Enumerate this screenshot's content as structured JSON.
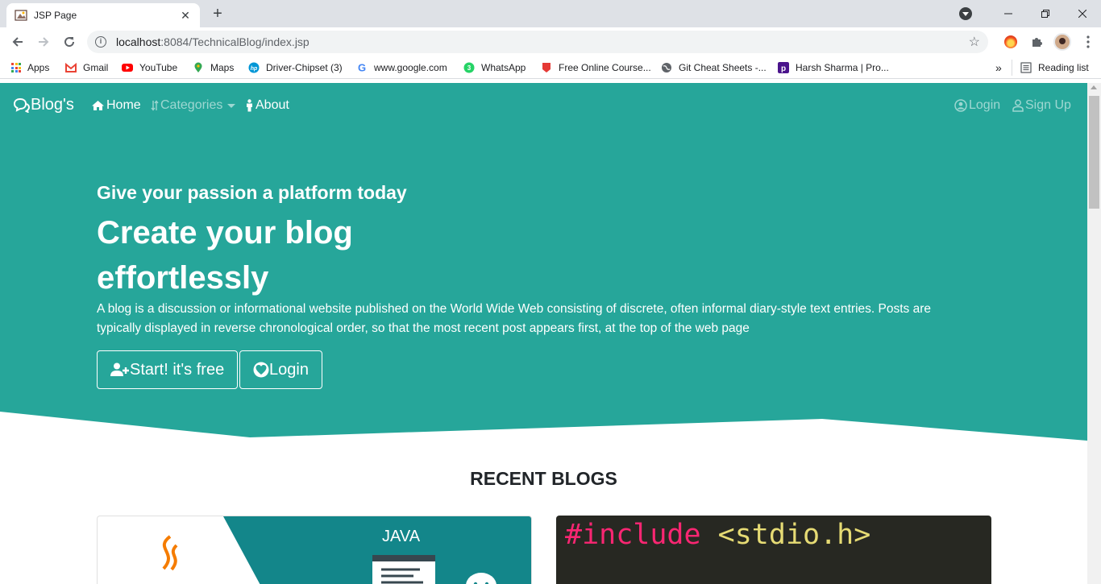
{
  "browser": {
    "tab_title": "JSP Page",
    "new_tab_symbol": "+",
    "close_symbol": "✕",
    "url_host": "localhost",
    "url_path": ":8084/TechnicalBlog/index.jsp",
    "bookmarks": [
      {
        "label": "Apps",
        "icon": "apps-grid-icon"
      },
      {
        "label": "Gmail",
        "icon": "gmail-icon",
        "color": "#ea4335"
      },
      {
        "label": "YouTube",
        "icon": "youtube-icon",
        "color": "#ff0000"
      },
      {
        "label": "Maps",
        "icon": "maps-pin-icon",
        "color": "#34a853"
      },
      {
        "label": "Driver-Chipset (3)",
        "icon": "hp-icon",
        "color": "#0096d6"
      },
      {
        "label": "www.google.com",
        "icon": "google-icon",
        "color": "#4285f4"
      },
      {
        "label": "WhatsApp",
        "icon": "whatsapp-icon",
        "color": "#25d366"
      },
      {
        "label": "Free Online Course...",
        "icon": "course-icon",
        "color": "#e53935"
      },
      {
        "label": "Git Cheat Sheets -...",
        "icon": "globe-icon",
        "color": "#5f6368"
      },
      {
        "label": "Harsh Sharma | Pro...",
        "icon": "profile-p-icon",
        "color": "#4a148c"
      }
    ],
    "overflow_label": "»",
    "reading_list_label": "Reading list"
  },
  "navbar": {
    "brand": "Blog's",
    "home": "Home",
    "categories": "Categories",
    "about": "About",
    "login": "Login",
    "signup": "Sign Up"
  },
  "hero": {
    "tagline": "Give your passion a platform today",
    "headline": "Create your blog effortlessly",
    "description": "A blog is a discussion or informational website published on the World Wide Web consisting of discrete, often informal diary-style text entries. Posts are typically displayed in reverse chronological order, so that the most recent post appears first, at the top of the web page",
    "start_button": "Start! it's free",
    "login_button": "Login"
  },
  "recent": {
    "title": "RECENT BLOGS",
    "java_card_label": "JAVA",
    "c_card_code_keyword": "#include",
    "c_card_code_header": "<stdio.h>"
  },
  "colors": {
    "primary": "#26a69a",
    "text_dark": "#212529"
  }
}
